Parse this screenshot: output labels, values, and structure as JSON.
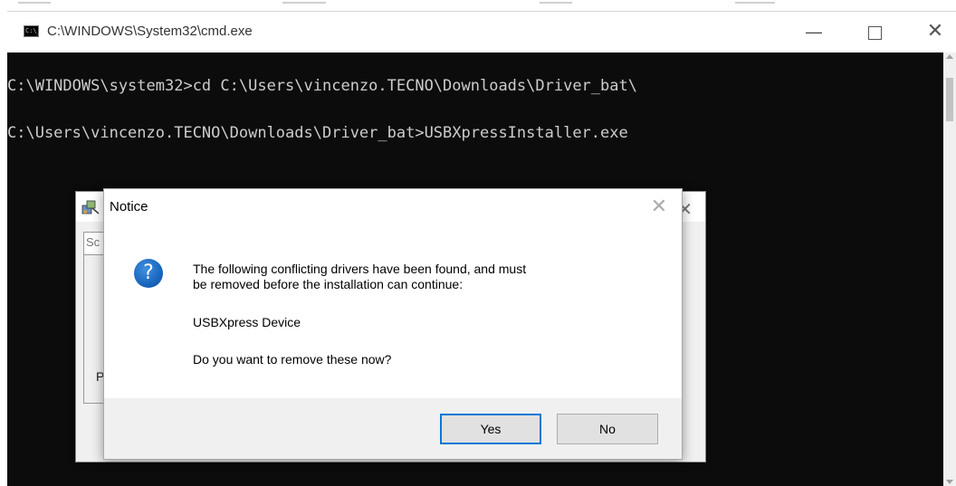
{
  "cmd_window": {
    "title": "C:\\WINDOWS\\System32\\cmd.exe",
    "icon": "cmd-icon",
    "icon_text": "C:\\_",
    "controls": {
      "minimize": "—",
      "maximize": "☐",
      "close": "✕"
    },
    "console_lines": [
      "C:\\WINDOWS\\system32>cd C:\\Users\\vincenzo.TECNO\\Downloads\\Driver_bat\\",
      "C:\\Users\\vincenzo.TECNO\\Downloads\\Driver_bat>USBXpressInstaller.exe"
    ]
  },
  "installer_window": {
    "icon": "installer-icon",
    "close": "✕",
    "field_text": "Sc",
    "label_text": "P"
  },
  "notice_dialog": {
    "title": "Notice",
    "close": "✕",
    "icon": "question-icon",
    "icon_glyph": "?",
    "message": "The following conflicting drivers have been found, and must\nbe removed before the installation can continue:",
    "driver_name": "USBXpress Device",
    "question": "Do you want to remove these now?",
    "buttons": {
      "yes": "Yes",
      "no": "No"
    }
  },
  "colors": {
    "console_bg": "#0c0c0c",
    "console_text": "#cccccc",
    "dialog_footer": "#f0f0f0",
    "default_button_border": "#0078d7"
  }
}
